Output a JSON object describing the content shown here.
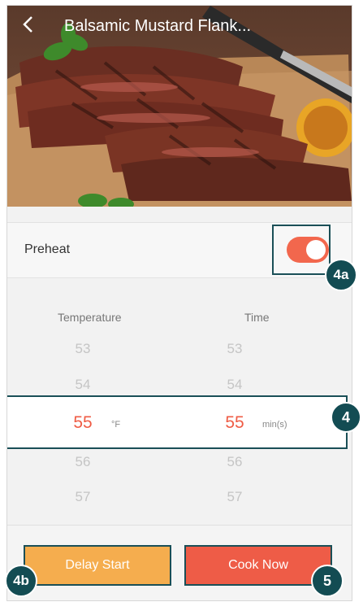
{
  "header": {
    "title": "Balsamic Mustard Flank..."
  },
  "preheat": {
    "label": "Preheat",
    "enabled": true
  },
  "picker": {
    "temperature": {
      "label": "Temperature",
      "above": [
        "53",
        "54"
      ],
      "selected": "55",
      "unit": "°F",
      "below": [
        "56",
        "57"
      ]
    },
    "time": {
      "label": "Time",
      "above": [
        "53",
        "54"
      ],
      "selected": "55",
      "unit": "min(s)",
      "below": [
        "56",
        "57"
      ]
    }
  },
  "buttons": {
    "delay_start": "Delay Start",
    "cook_now": "Cook Now"
  },
  "callouts": {
    "toggle": "4a",
    "picker": "4",
    "delay": "4b",
    "cook": "5"
  },
  "colors": {
    "accent": "#ef5c45",
    "toggle": "#f2674d",
    "delay": "#f5ad4e",
    "cook": "#ee5c47",
    "callout": "#134c53"
  }
}
